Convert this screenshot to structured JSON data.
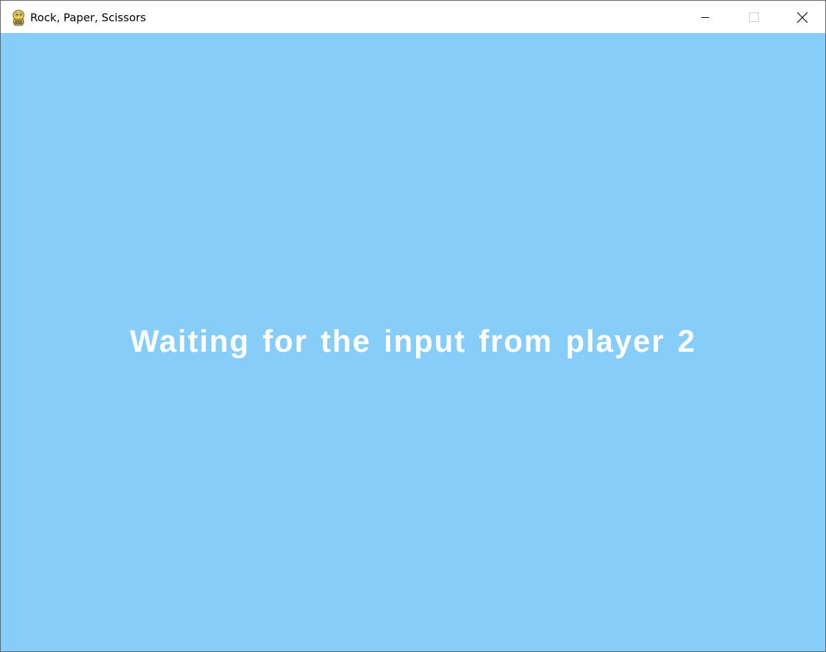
{
  "window": {
    "title": "Rock, Paper, Scissors",
    "app_icon": "pygame-snake-icon",
    "controls": {
      "minimize_icon": "minimize-icon",
      "maximize_icon": "maximize-icon",
      "close_icon": "close-icon"
    }
  },
  "game": {
    "background_color": "#87cdf9",
    "status_message": "Waiting for the input from player 2",
    "text_color": "#ffffff"
  }
}
